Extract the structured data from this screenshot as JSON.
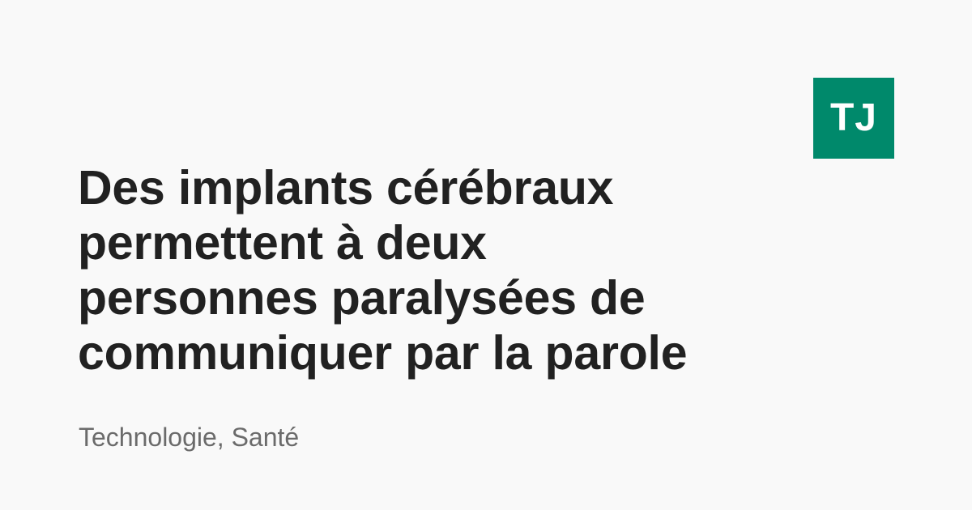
{
  "brand": {
    "logo_text": "TJ",
    "logo_color": "#00896b"
  },
  "article": {
    "title_lines": [
      "Des implants cérébraux",
      "permettent à deux",
      "personnes paralysées de",
      "communiquer par la parole"
    ],
    "tags": "Technologie, Santé"
  },
  "colors": {
    "background": "#f9f9f9",
    "title": "#212121",
    "tags": "#6b6b6b"
  }
}
